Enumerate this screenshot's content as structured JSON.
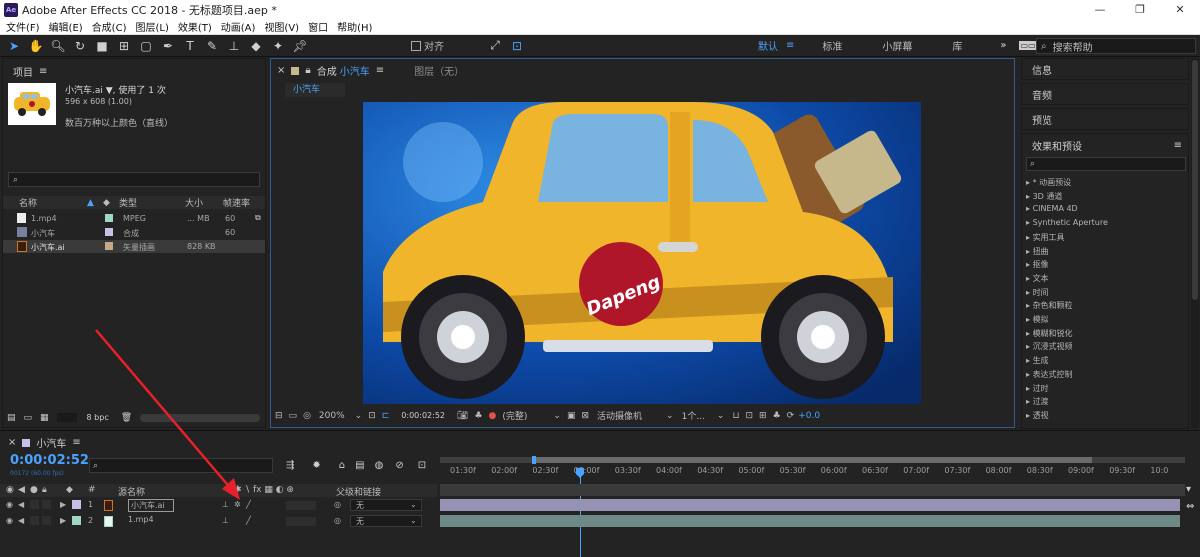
{
  "window": {
    "title": "Adobe After Effects CC 2018 - 无标题项目.aep *",
    "logo": "Ae",
    "min": "—",
    "max": "❐",
    "close": "✕"
  },
  "menu": [
    "文件(F)",
    "编辑(E)",
    "合成(C)",
    "图层(L)",
    "效果(T)",
    "动画(A)",
    "视图(V)",
    "窗口",
    "帮助(H)"
  ],
  "toolbar": {
    "snap_label": "对齐",
    "workspaces": [
      "默认",
      "标准",
      "小屏幕",
      "库"
    ],
    "search_placeholder": "搜索帮助"
  },
  "project": {
    "title": "项目",
    "item_name": "小汽车.ai ▼",
    "usage": ", 使用了 1 次",
    "dims": "596 x 608 (1.00)",
    "color_info": "数百万种以上颜色（直线）",
    "search_icon": "⌕",
    "columns": {
      "name": "名称",
      "type": "类型",
      "size": "大小",
      "fps": "帧速率"
    },
    "rows": [
      {
        "name": "1.mp4",
        "color": "#9fd6c8",
        "type": "MPEG",
        "size": "... MB",
        "fps": "60"
      },
      {
        "name": "小汽车",
        "color": "#c9c0e8",
        "type": "合成",
        "size": "",
        "fps": "60"
      },
      {
        "name": "小汽车.ai",
        "color": "#c9a78b",
        "type": "矢量插画",
        "size": "828 KB",
        "fps": ""
      }
    ],
    "bpc": "8 bpc"
  },
  "viewer": {
    "tab_comp": "合成",
    "tab_comp_name": "小汽车",
    "tab_layer": "图层（无）",
    "breadcrumb": "小汽车",
    "car_text": "Dapeng",
    "zoom": "200%",
    "timecode": "0:00:02:52",
    "quality": "(完整)",
    "camera": "活动摄像机",
    "views": "1个...",
    "exposure": "+0.0"
  },
  "right": {
    "info": "信息",
    "audio": "音频",
    "preview": "预览",
    "effects_title": "效果和预设",
    "effects": [
      "* 动画预设",
      "3D 通道",
      "CINEMA 4D",
      "Synthetic Aperture",
      "实用工具",
      "扭曲",
      "抠像",
      "文本",
      "时间",
      "杂色和颗粒",
      "模拟",
      "模糊和锐化",
      "沉浸式视频",
      "生成",
      "表达式控制",
      "过时",
      "过渡",
      "透视"
    ]
  },
  "timeline": {
    "comp_name": "小汽车",
    "timecode": "0:00:02:52",
    "timecode_sub": "00172 (60.00 fps)",
    "ruler": [
      "01:30f",
      "02:00f",
      "02:30f",
      "03:00f",
      "03:30f",
      "04:00f",
      "04:30f",
      "05:00f",
      "05:30f",
      "06:00f",
      "06:30f",
      "07:00f",
      "07:30f",
      "08:00f",
      "08:30f",
      "09:00f",
      "09:30f",
      "10:0"
    ],
    "cols": {
      "num": "#",
      "source": "源名称",
      "parent": "父级和链接"
    },
    "layers": [
      {
        "num": "1",
        "name": "小汽车.ai",
        "parent": "无",
        "color": "#c9c0e8"
      },
      {
        "num": "2",
        "name": "1.mp4",
        "parent": "无",
        "color": "#9fd6c8"
      }
    ]
  },
  "colors": {
    "accent": "#4aa3ff",
    "panel": "#232323",
    "arrow": "#e8202a",
    "car": "#f0b52a"
  }
}
